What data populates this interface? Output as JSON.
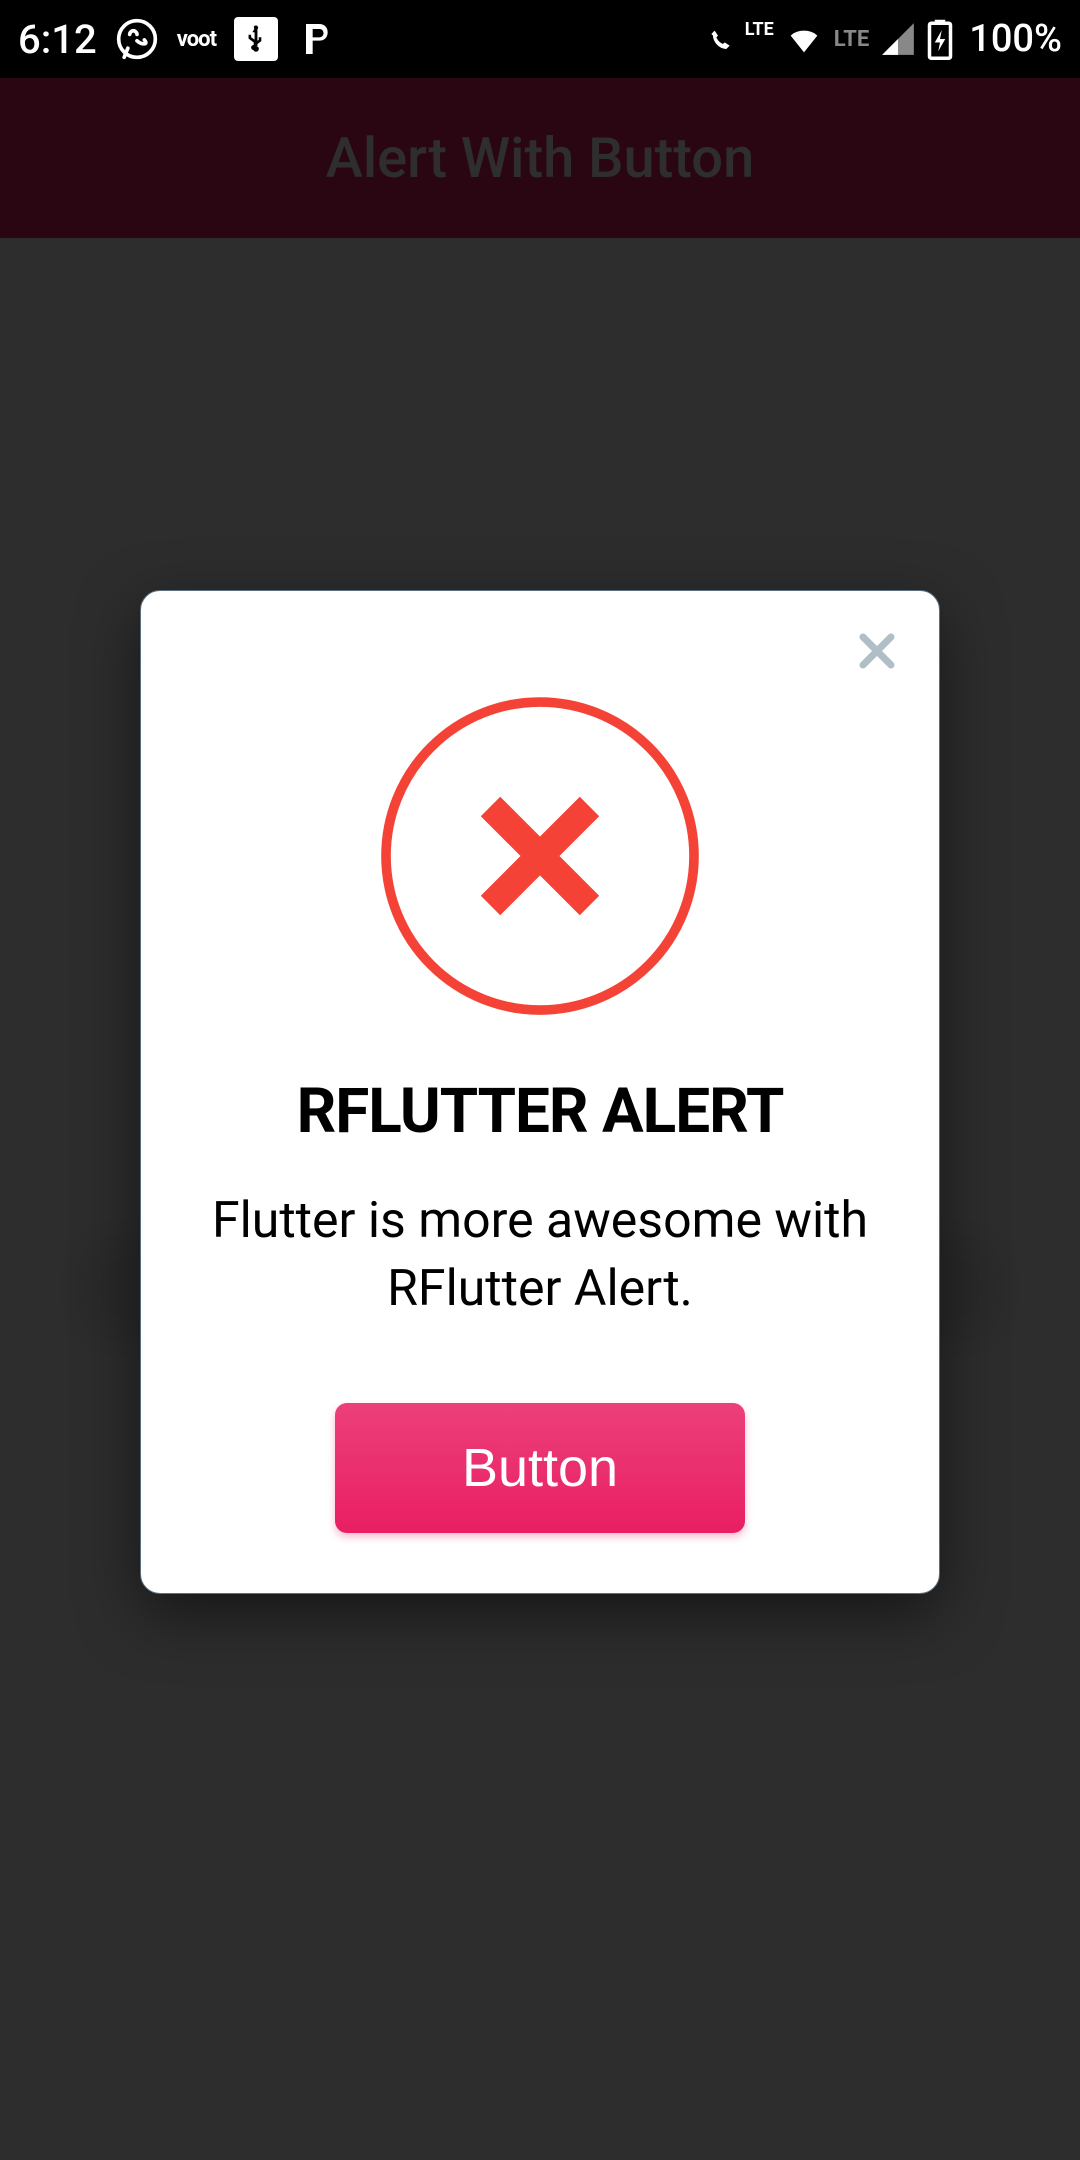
{
  "status_bar": {
    "time": "6:12",
    "voot_label": "voot",
    "lte_label": "LTE",
    "battery_percent": "100%"
  },
  "app_bar": {
    "title": "Alert With Button"
  },
  "dialog": {
    "title": "RFLUTTER ALERT",
    "message": "Flutter is more awesome with RFlutter Alert.",
    "button_label": "Button"
  },
  "colors": {
    "accent": "#E91E63",
    "error_icon": "#F44336"
  }
}
